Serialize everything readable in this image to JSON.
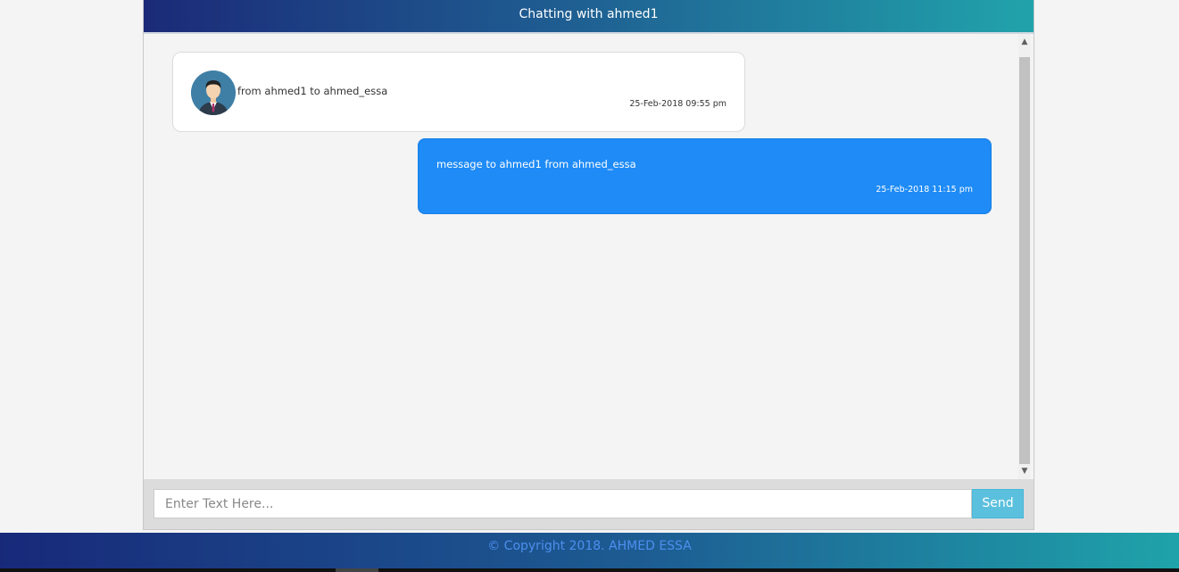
{
  "header": {
    "title": "Chatting with ahmed1"
  },
  "messages": {
    "incoming": {
      "text": "from ahmed1 to ahmed_essa",
      "timestamp": "25-Feb-2018 09:55 pm",
      "avatar_icon": "user-avatar-icon"
    },
    "outgoing": {
      "text": "message to ahmed1 from ahmed_essa",
      "timestamp": "25-Feb-2018 11:15 pm"
    }
  },
  "composer": {
    "placeholder": "Enter Text Here...",
    "value": "",
    "send_label": "Send"
  },
  "footer": {
    "copyright": "© Copyright 2018. AHMED ESSA"
  },
  "colors": {
    "accent_blue": "#1e8bf7",
    "send_button": "#5bc0de",
    "header_start": "#1b2a78",
    "header_end": "#21a3ab"
  }
}
